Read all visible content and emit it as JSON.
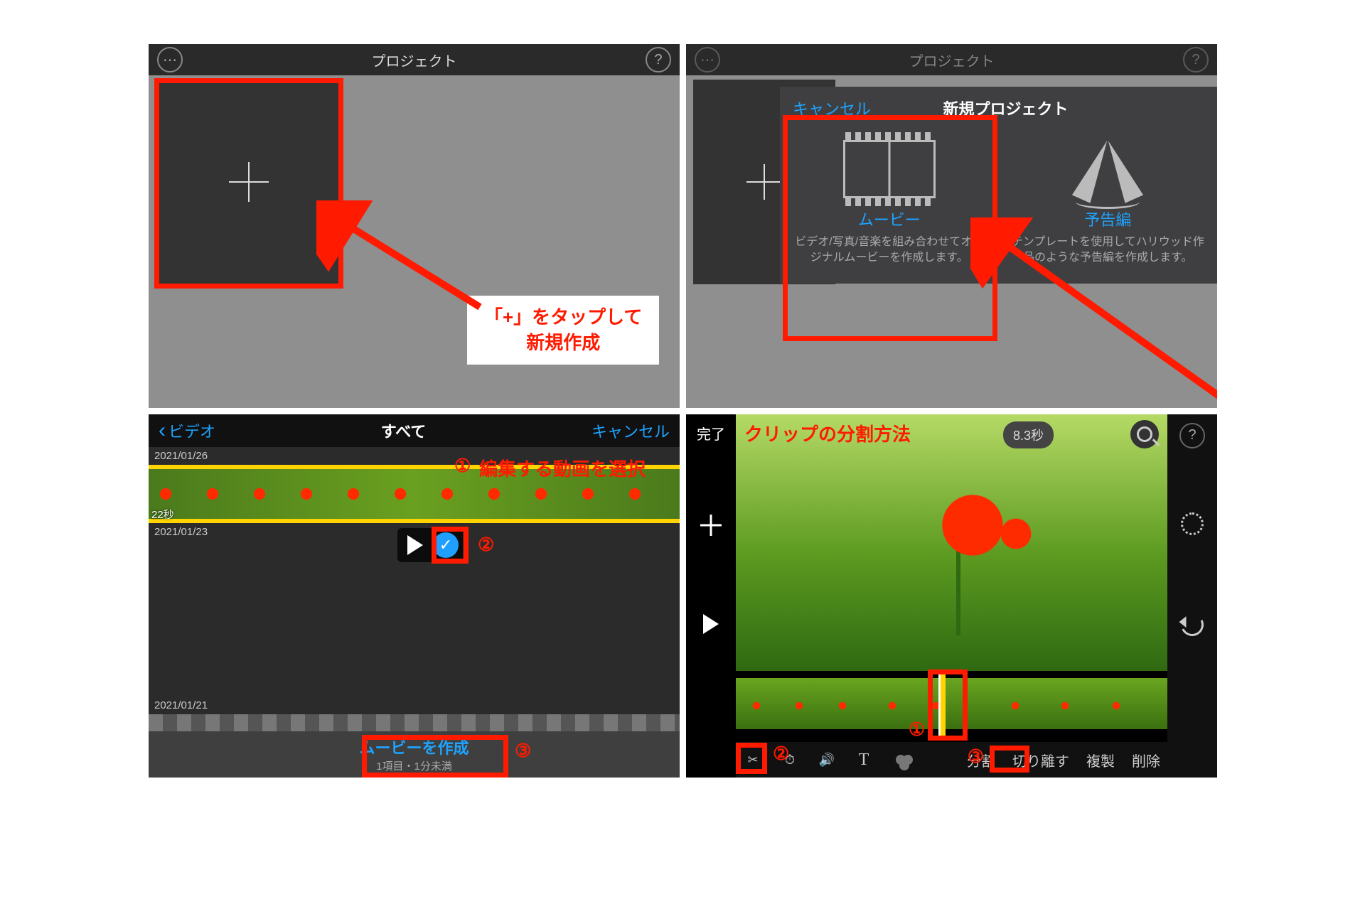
{
  "panelA": {
    "title": "プロジェクト",
    "annotation": "「+」をタップして\n新規作成"
  },
  "panelB": {
    "title": "プロジェクト",
    "sheet": {
      "cancel": "キャンセル",
      "title": "新規プロジェクト",
      "movie": {
        "label": "ムービー",
        "desc": "ビデオ/写真/音楽を組み合わせてオリジナルムービーを作成します。"
      },
      "trailer": {
        "label": "予告編",
        "desc": "テンプレートを使用してハリウッド作品のような予告編を作成します。"
      }
    }
  },
  "panelC": {
    "back": "ビデオ",
    "title": "すべて",
    "cancel": "キャンセル",
    "dates": {
      "d1": "2021/01/26",
      "d2": "2021/01/23",
      "d3": "2021/01/21"
    },
    "clipDuration": "22秒",
    "annot1": "編集する動画を選択",
    "num1": "①",
    "num2": "②",
    "num3": "③",
    "footer": {
      "make": "ムービーを作成",
      "sub": "1項目・1分未満"
    }
  },
  "panelD": {
    "done": "完了",
    "heading": "クリップの分割方法",
    "badge": "8.3秒",
    "num1": "①",
    "num2": "②",
    "num3": "③",
    "actions": {
      "split": "分割",
      "detach": "切り離す",
      "duplicate": "複製",
      "delete": "削除"
    }
  }
}
